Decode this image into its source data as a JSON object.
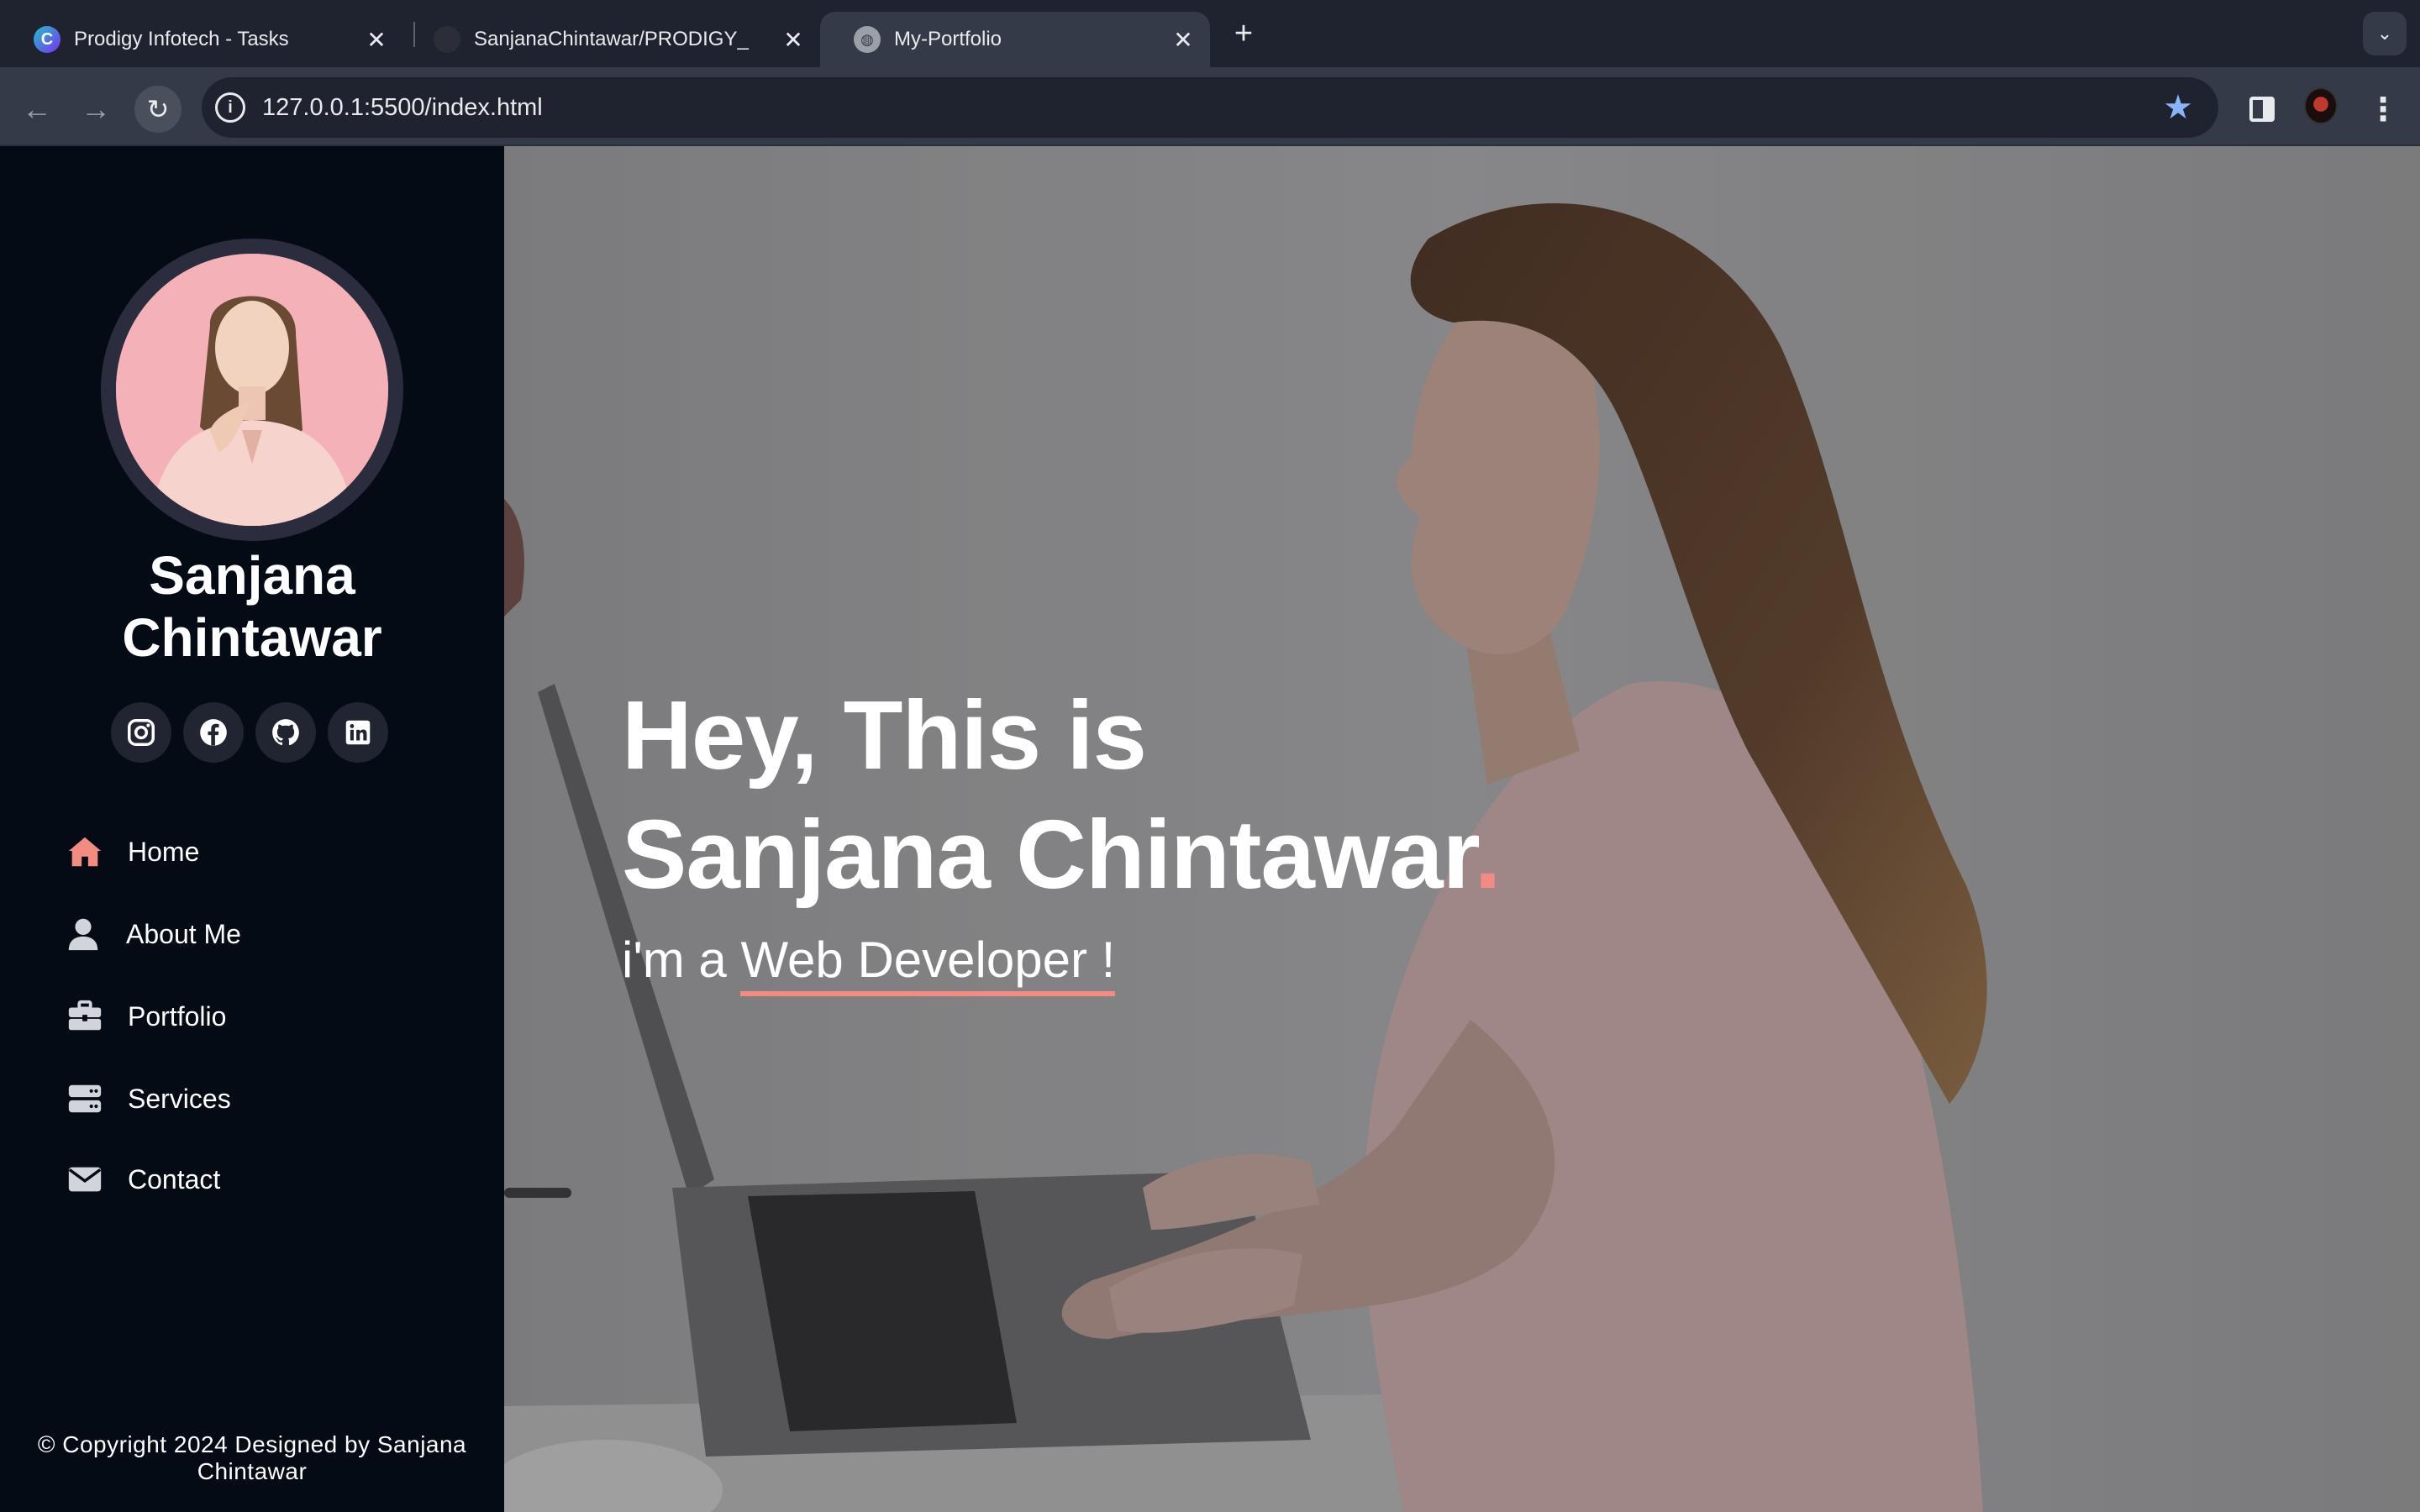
{
  "browser": {
    "tabs": [
      {
        "title": "Prodigy Infotech - Tasks",
        "favicon": "canva-icon"
      },
      {
        "title": "SanjanaChintawar/PRODIGY_",
        "favicon": "github-icon"
      },
      {
        "title": "My-Portfolio",
        "favicon": "globe-icon"
      }
    ],
    "url": "127.0.0.1:5500/index.html"
  },
  "sidebar": {
    "name_line1": "Sanjana",
    "name_line2": "Chintawar",
    "socials": [
      "instagram-icon",
      "facebook-icon",
      "github-icon",
      "linkedin-icon"
    ],
    "nav": [
      {
        "label": "Home",
        "icon": "home-icon"
      },
      {
        "label": "About Me",
        "icon": "user-icon"
      },
      {
        "label": "Portfolio",
        "icon": "briefcase-icon"
      },
      {
        "label": "Services",
        "icon": "server-icon"
      },
      {
        "label": "Contact",
        "icon": "envelope-icon"
      }
    ],
    "footer_line1": "© Copyright 2024 Designed by Sanjana",
    "footer_line2": "Chintawar"
  },
  "hero": {
    "line1": "Hey, This is",
    "line2": "Sanjana Chintawar",
    "dot": ".",
    "sub_prefix": "i'm a ",
    "role": "Web Developer !"
  },
  "colors": {
    "accent": "#f28b82",
    "sidebar_bg": "#040b14",
    "social_bg": "#212431",
    "chrome_bg": "#1f2330",
    "chrome_active": "#353a48"
  }
}
